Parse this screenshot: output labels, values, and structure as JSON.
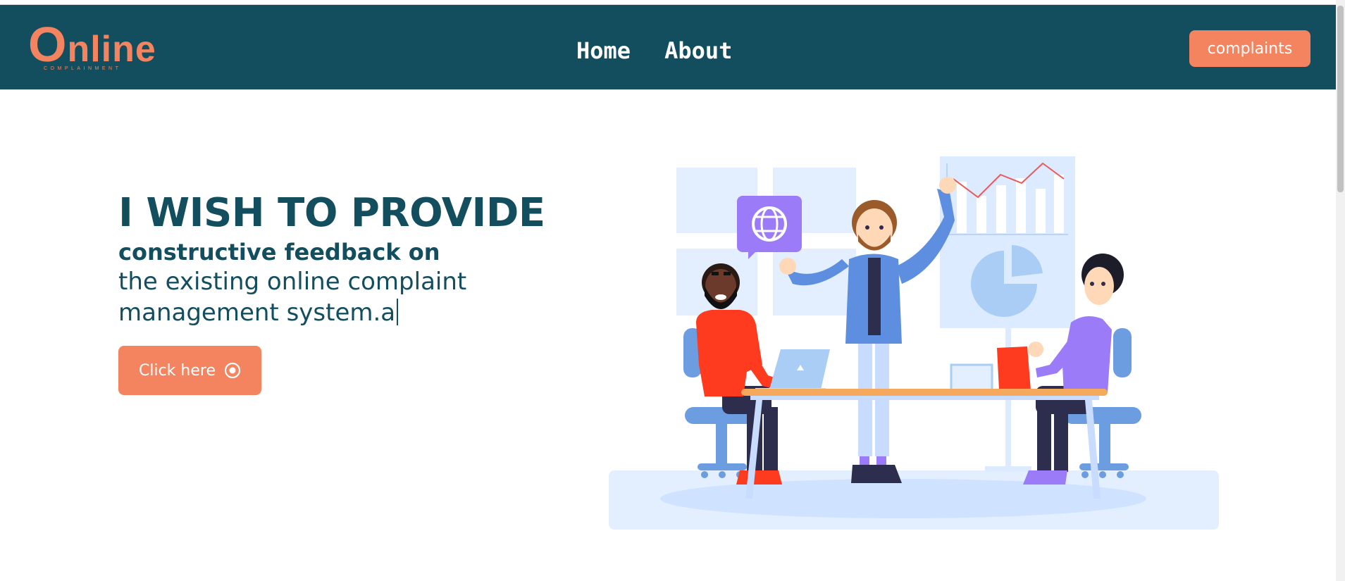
{
  "header": {
    "logo_text": "Online",
    "logo_subtext": "COMPLAINMENT",
    "nav": [
      {
        "label": "Home"
      },
      {
        "label": "About"
      }
    ],
    "cta_label": "complaints"
  },
  "hero": {
    "headline": "I WISH TO PROVIDE",
    "subheadline": "constructive feedback on",
    "line1": "the existing online complaint",
    "line2": "management system.a",
    "button_label": "Click here",
    "button_icon": "record-circle-icon"
  },
  "illustration": {
    "subject": "team-meeting-illustration",
    "icons": [
      "globe-icon",
      "line-chart-icon",
      "pie-chart-icon",
      "laptop-icon"
    ]
  },
  "colors": {
    "navbar_bg": "#134e5e",
    "accent": "#f4845f",
    "heading_text": "#134e5e",
    "background": "#ffffff"
  }
}
